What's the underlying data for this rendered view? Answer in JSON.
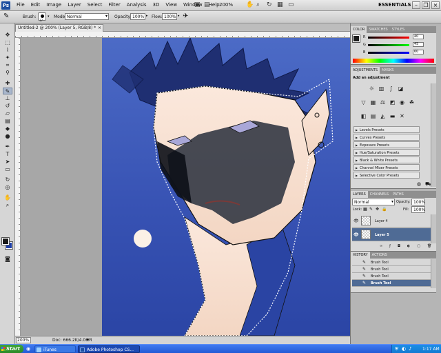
{
  "menubar": {
    "logo": "Ps",
    "items": [
      "File",
      "Edit",
      "Image",
      "Layer",
      "Select",
      "Filter",
      "Analysis",
      "3D",
      "View",
      "Window",
      "Help"
    ],
    "zoom": "200%",
    "workspace": "ESSENTIALS"
  },
  "options": {
    "brush_label": "Brush:",
    "brush_size": "17",
    "mode_label": "Mode:",
    "mode_value": "Normal",
    "opacity_label": "Opacity:",
    "opacity_value": "100%",
    "flow_label": "Flow:",
    "flow_value": "100%"
  },
  "document": {
    "tab_title": "Untitled-2 @ 200% (Layer 5, RGB/8) *",
    "zoom": "200%",
    "doc_info": "Doc: 666.2K/4.06M"
  },
  "color_panel": {
    "tabs": [
      "COLOR",
      "SWATCHES",
      "STYLES"
    ],
    "r_label": "R",
    "r_value": "40",
    "g_label": "G",
    "g_value": "45",
    "b_label": "B",
    "b_value": "60"
  },
  "adjustments_panel": {
    "tabs": [
      "ADJUSTMENTS",
      "MASKS"
    ],
    "heading": "Add an adjustment",
    "presets": [
      "Levels Presets",
      "Curves Presets",
      "Exposure Presets",
      "Hue/Saturation Presets",
      "Black & White Presets",
      "Channel Mixer Presets",
      "Selective Color Presets"
    ]
  },
  "layers_panel": {
    "tabs": [
      "LAYERS",
      "CHANNELS",
      "PATHS"
    ],
    "blend_mode": "Normal",
    "opacity_label": "Opacity:",
    "opacity_value": "100%",
    "lock_label": "Lock:",
    "fill_label": "Fill:",
    "fill_value": "100%",
    "layers": [
      {
        "name": "Layer 4",
        "selected": false
      },
      {
        "name": "Layer 5",
        "selected": true
      }
    ]
  },
  "history_panel": {
    "tabs": [
      "HISTORY",
      "ACTIONS"
    ],
    "items": [
      "Brush Tool",
      "Brush Tool",
      "Brush Tool",
      "Brush Tool"
    ]
  },
  "taskbar": {
    "start": "Start",
    "tasks": [
      "iTunes",
      "Adobe Photoshop CS..."
    ],
    "clock": "1:17 AM"
  },
  "colors": {
    "canvas_top": "#4c6bc6",
    "canvas_bottom": "#2b45a5",
    "selection_highlight": "#4f6b95",
    "foreground": "#1a1a1a",
    "background": "#1e3ea7"
  },
  "icons": {
    "tools": [
      "move-icon",
      "marquee-icon",
      "lasso-icon",
      "quick-select-icon",
      "crop-icon",
      "eyedropper-icon",
      "healing-icon",
      "brush-icon",
      "stamp-icon",
      "history-brush-icon",
      "eraser-icon",
      "gradient-icon",
      "blur-icon",
      "dodge-icon",
      "pen-icon",
      "type-icon",
      "path-select-icon",
      "shape-icon",
      "3d-rotate-icon",
      "3d-camera-icon",
      "hand-icon",
      "zoom-icon"
    ]
  }
}
